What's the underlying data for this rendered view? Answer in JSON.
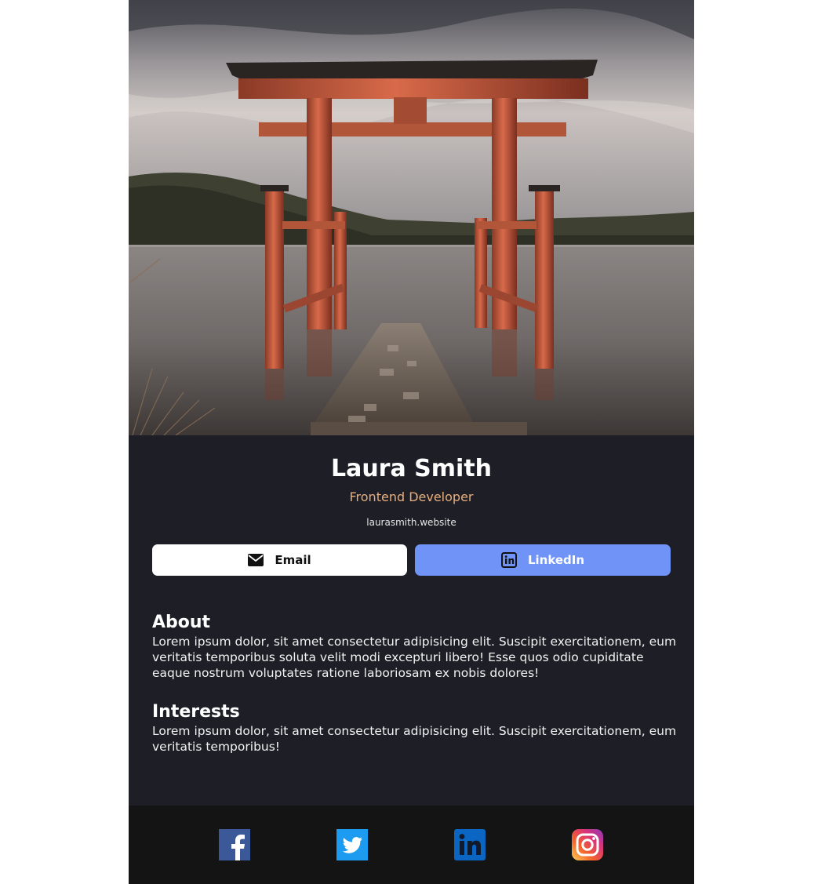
{
  "profile": {
    "name": "Laura Smith",
    "role": "Frontend Developer",
    "website": "laurasmith.website"
  },
  "buttons": {
    "email_label": "Email",
    "email_icon": "envelope-icon",
    "linkedin_label": "LinkedIn",
    "linkedin_icon": "linkedin-icon"
  },
  "about": {
    "title": "About",
    "body": "Lorem ipsum dolor, sit amet consectetur adipisicing elit. Suscipit exercitationem, eum veritatis temporibus soluta velit modi excepturi libero! Esse quos odio cupiditate eaque nostrum voluptates ratione laboriosam ex nobis dolores!"
  },
  "interests": {
    "title": "Interests",
    "body": "Lorem ipsum dolor, sit amet consectetur adipisicing elit. Suscipit exercitationem, eum veritatis temporibus!"
  },
  "footer": {
    "icons": [
      "facebook-icon",
      "twitter-icon",
      "linkedin-icon",
      "instagram-icon"
    ]
  },
  "colors": {
    "card_bg": "#1e1f26",
    "footer_bg": "#141414",
    "role_accent": "#e9ae7c",
    "linkedin_button": "#6f93f6",
    "email_button": "#ffffff"
  }
}
